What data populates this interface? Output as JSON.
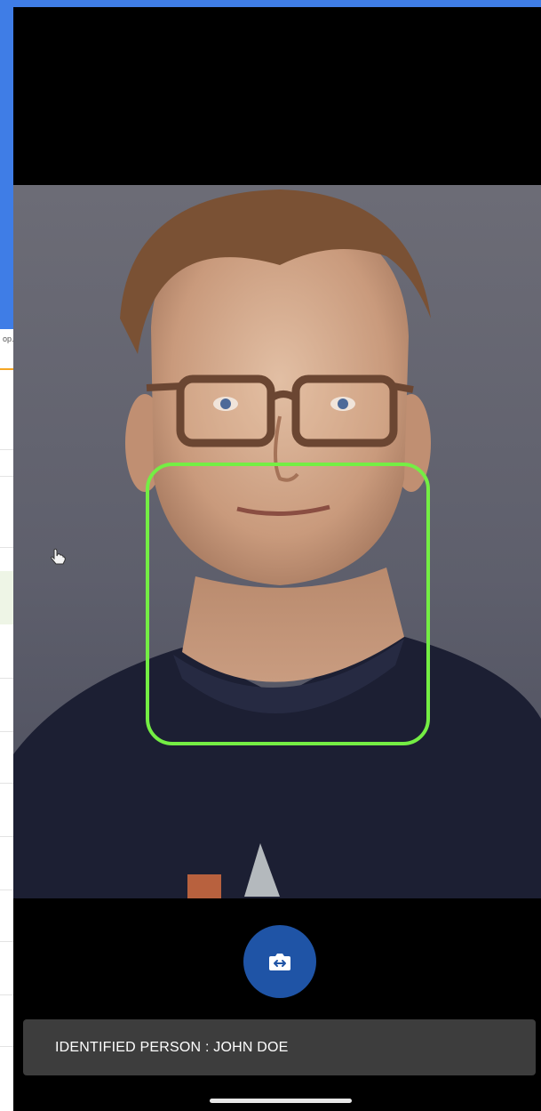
{
  "background_window": {
    "url_fragment": "op.p"
  },
  "camera": {
    "face_box_color": "#74ee44",
    "switch_camera_icon": "switch-camera-icon"
  },
  "status": {
    "text": "IDENTIFIED PERSON  : JOHN DOE"
  },
  "colors": {
    "accent_blue": "#1f54a6",
    "desktop_blue": "#3f7de6",
    "status_bar_bg": "#3d3d3d"
  }
}
